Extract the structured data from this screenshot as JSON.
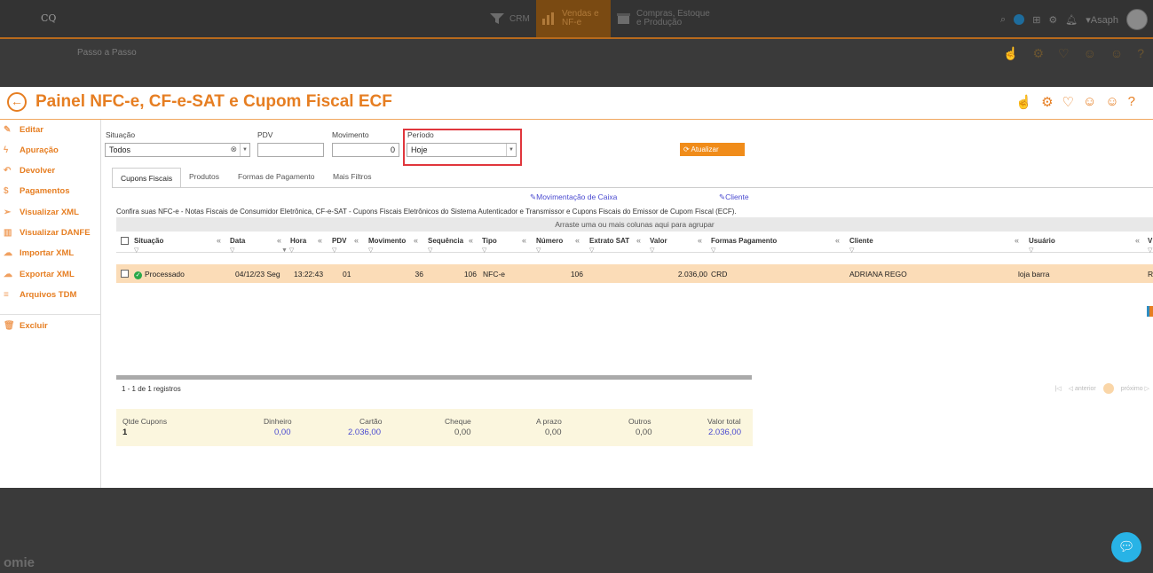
{
  "topbar": {
    "logo": "CQ",
    "modules": [
      {
        "label": "CRM"
      },
      {
        "label_line1": "Vendas e",
        "label_line2": "NF-e"
      },
      {
        "label_line1": "Compras, Estoque",
        "label_line2": "e Produção"
      }
    ],
    "user": "Asaph",
    "user_caret": "▾"
  },
  "stepbar": {
    "label": "Passo a Passo"
  },
  "page": {
    "title": "Painel NFC-e, CF-e-SAT e Cupom Fiscal ECF",
    "help": "?"
  },
  "sidebar": {
    "items": [
      {
        "label": "Editar",
        "icon": "pencil-icon"
      },
      {
        "label": "Apuração",
        "icon": "lightning-icon"
      },
      {
        "label": "Devolver",
        "icon": "undo-icon"
      },
      {
        "label": "Pagamentos",
        "icon": "dollar-icon"
      },
      {
        "label": "Visualizar XML",
        "icon": "send-icon"
      },
      {
        "label": "Visualizar DANFE",
        "icon": "barcode-icon"
      },
      {
        "label": "Importar XML",
        "icon": "cloud-upload-icon"
      },
      {
        "label": "Exportar XML",
        "icon": "cloud-download-icon"
      },
      {
        "label": "Arquivos TDM",
        "icon": "menu-icon"
      },
      {
        "label": "Excluir",
        "icon": "trash-icon"
      }
    ]
  },
  "filters": {
    "situacao_label": "Situação",
    "situacao_value": "Todos",
    "pdv_label": "PDV",
    "pdv_value": "",
    "movimento_label": "Movimento",
    "movimento_value": "0",
    "periodo_label": "Período",
    "periodo_value": "Hoje",
    "refresh_label": "Atualizar"
  },
  "tabs": [
    "Cupons Fiscais",
    "Produtos",
    "Formas de Pagamento",
    "Mais Filtros"
  ],
  "links": {
    "movimentacao": "Movimentação de Caixa",
    "cliente": "Cliente"
  },
  "description": "Confira suas NFC-e - Notas Fiscais de Consumidor Eletrônica, CF-e-SAT - Cupons Fiscais Eletrônicos do Sistema Autenticador e Transmissor e Cupons Fiscais do Emissor de Cupom Fiscal (ECF).",
  "grid": {
    "group_hint": "Arraste uma ou mais colunas aqui para agrupar",
    "columns": [
      "Situação",
      "Data",
      "Hora",
      "PDV",
      "Movimento",
      "Sequência",
      "Tipo",
      "Número",
      "Extrato SAT",
      "Valor",
      "Formas Pagamento",
      "Cliente",
      "Usuário",
      "V"
    ],
    "rows": [
      {
        "situacao": "Processado",
        "data": "04/12/23 Seg",
        "hora": "13:22:43",
        "pdv": "01",
        "movimento": "36",
        "sequencia": "106",
        "tipo": "NFC-e",
        "numero": "106",
        "extrato_sat": "",
        "valor": "2.036,00",
        "formas_pagamento": "CRD",
        "cliente": "ADRIANA REGO",
        "usuario": "loja barra",
        "v": "R"
      }
    ],
    "pager_text": "1 - 1 de 1 registros",
    "pager_prev": "anterior",
    "pager_next": "próximo",
    "pager_first": "|◁",
    "pager_prev_arrow": "◁",
    "pager_next_arrow": "▷"
  },
  "summary": {
    "qtde_label": "Qtde Cupons",
    "qtde_value": "1",
    "dinheiro_label": "Dinheiro",
    "dinheiro_value": "0,00",
    "cartao_label": "Cartão",
    "cartao_value": "2.036,00",
    "cheque_label": "Cheque",
    "cheque_value": "0,00",
    "aprazo_label": "A prazo",
    "aprazo_value": "0,00",
    "outros_label": "Outros",
    "outros_value": "0,00",
    "total_label": "Valor total",
    "total_value": "2.036,00"
  },
  "footer": {
    "brand": "omie"
  },
  "colors": {
    "accent": "#e67e22",
    "link": "#4a4ad0",
    "row_selected": "#fbdcb7",
    "highlight": "#e0363c"
  }
}
